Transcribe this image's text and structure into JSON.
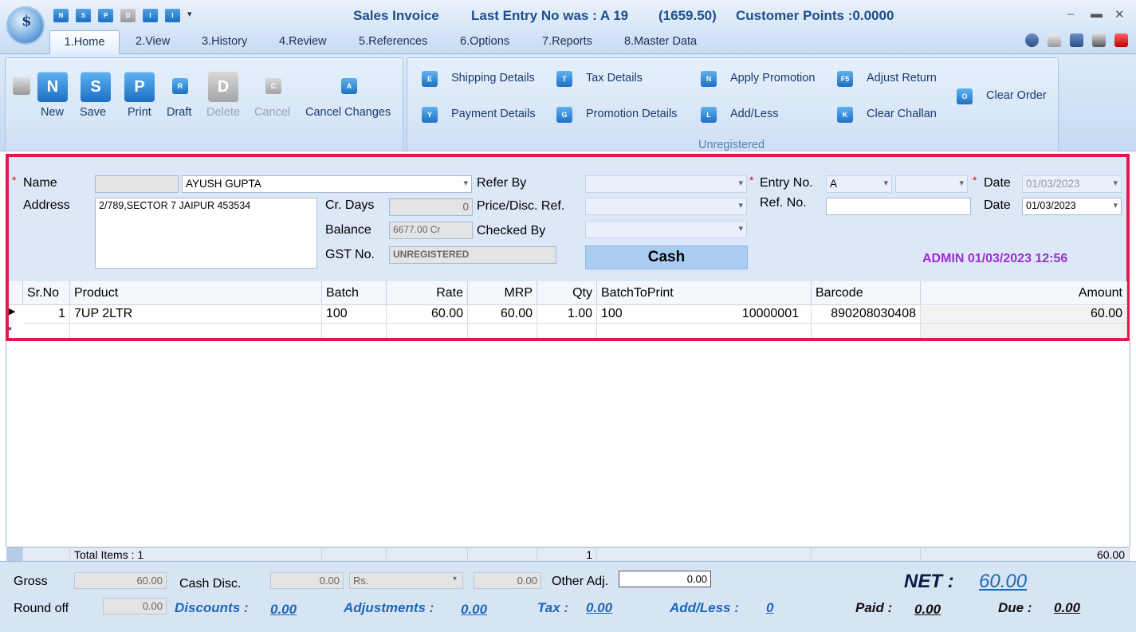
{
  "titlebar": {
    "title": "Sales Invoice",
    "last_entry": "Last Entry No was : A 19",
    "last_amount": "(1659.50)",
    "customer_points": "Customer Points :0.0000",
    "quick_access": [
      "N",
      "S",
      "P",
      "D",
      "I",
      "I"
    ]
  },
  "tabs": [
    "1.Home",
    "2.View",
    "3.History",
    "4.Review",
    "5.References",
    "6.Options",
    "7.Reports",
    "8.Master Data"
  ],
  "ribbon": {
    "buttons": {
      "new": "New",
      "save": "Save",
      "print": "Print",
      "draft": "Draft",
      "delete": "Delete",
      "cancel": "Cancel",
      "cancel_changes": "Cancel Changes"
    },
    "actions": {
      "shipping_details": "Shipping Details",
      "payment_details": "Payment Details",
      "tax_details": "Tax Details",
      "promotion_details": "Promotion Details",
      "apply_promotion": "Apply Promotion",
      "add_less": "Add/Less",
      "adjust_return": "Adjust Return",
      "clear_challan": "Clear Challan",
      "clear_order": "Clear Order"
    },
    "group_label": "Unregistered"
  },
  "form": {
    "name_label": "Name",
    "name_value": "AYUSH GUPTA",
    "address_label": "Address",
    "address_value": "2/789,SECTOR 7 JAIPUR 453534",
    "cr_days_label": "Cr. Days",
    "cr_days_value": "0",
    "balance_label": "Balance",
    "balance_value": "6677.00 Cr",
    "gst_label": "GST No.",
    "gst_value": "UNREGISTERED",
    "refer_by_label": "Refer By",
    "price_disc_label": "Price/Disc. Ref.",
    "checked_by_label": "Checked By",
    "cash_button": "Cash",
    "entry_no_label": "Entry No.",
    "entry_prefix": "A",
    "date_label": "Date",
    "date_value": "01/03/2023",
    "ref_no_label": "Ref. No.",
    "date2_label": "Date",
    "date2_value": "01/03/2023",
    "admin_stamp": "ADMIN 01/03/2023 12:56"
  },
  "grid": {
    "headers": [
      "Sr.No",
      "Product",
      "Batch",
      "Rate",
      "MRP",
      "Qty",
      "BatchToPrint",
      "Barcode",
      "Amount"
    ],
    "rows": [
      {
        "srno": "1",
        "product": "7UP 2LTR",
        "batch": "100",
        "rate": "60.00",
        "mrp": "60.00",
        "qty": "1.00",
        "batch_to_print": "100",
        "batch_code": "10000001",
        "barcode": "890208030408",
        "amount": "60.00"
      }
    ],
    "totals": {
      "label": "Total Items : 1",
      "qty": "1",
      "amount": "60.00"
    }
  },
  "bottom": {
    "gross_label": "Gross",
    "gross_value": "60.00",
    "cash_disc_label": "Cash Disc.",
    "cash_disc_value": "0.00",
    "cash_disc_unit": "Rs.",
    "cash_disc_amount": "0.00",
    "other_adj_label": "Other Adj.",
    "other_adj_value": "0.00",
    "round_off_label": "Round off",
    "round_off_value": "0.00",
    "discounts_label": "Discounts :",
    "discounts_value": "0.00",
    "adjustments_label": "Adjustments :",
    "adjustments_value": "0.00",
    "tax_label": "Tax :",
    "tax_value": "0.00",
    "add_less_label": "Add/Less :",
    "add_less_value": "0",
    "net_label": "NET :",
    "net_value": "60.00",
    "paid_label": "Paid :",
    "paid_value": "0.00",
    "due_label": "Due :",
    "due_value": "0.00"
  },
  "colors": {
    "accent_border": "#e8154c",
    "admin_stamp": "#9b2fd0",
    "link_blue": "#1c68b8"
  }
}
